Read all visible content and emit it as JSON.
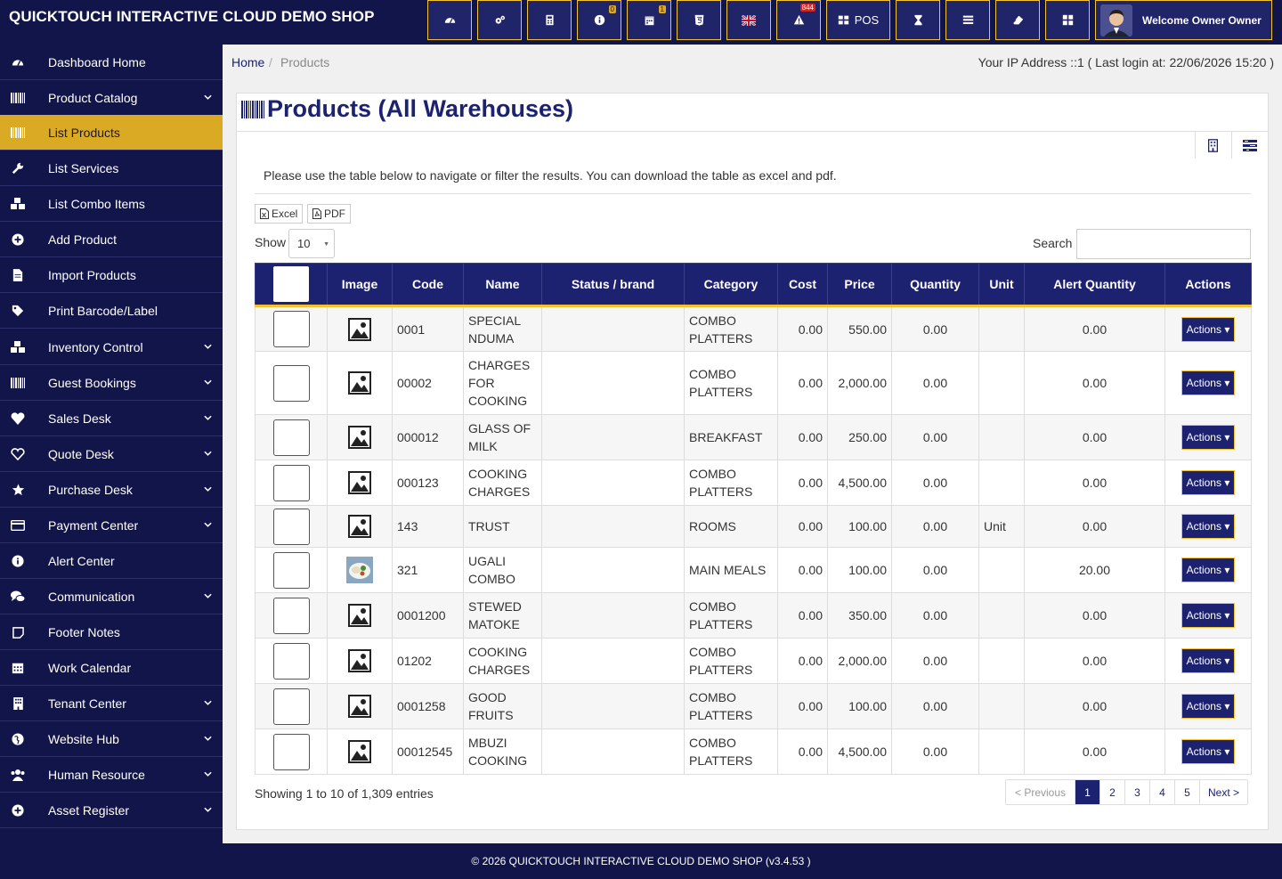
{
  "app": {
    "brand": "QUICKTOUCH INTERACTIVE CLOUD DEMO SHOP",
    "welcome": "Welcome Owner Owner",
    "toolbar": {
      "pos_label": "POS",
      "badge_info": "0",
      "badge_calendar": "1",
      "badge_alert": "844"
    }
  },
  "sidebar": {
    "items": [
      {
        "label": "Dashboard Home",
        "icon": "dashboard-icon"
      },
      {
        "label": "Product Catalog",
        "icon": "barcode-icon"
      },
      {
        "label": "List Products",
        "icon": "barcode-icon"
      },
      {
        "label": "List Services",
        "icon": "wrench-icon"
      },
      {
        "label": "List Combo Items",
        "icon": "cubes-icon"
      },
      {
        "label": "Add Product",
        "icon": "plus-circle-icon"
      },
      {
        "label": "Import Products",
        "icon": "file-icon"
      },
      {
        "label": "Print Barcode/Label",
        "icon": "tags-icon"
      },
      {
        "label": "Inventory Control",
        "icon": "cubes-icon"
      },
      {
        "label": "Guest Bookings",
        "icon": "barcode-icon"
      },
      {
        "label": "Sales Desk",
        "icon": "heart-icon"
      },
      {
        "label": "Quote Desk",
        "icon": "heart-outline-icon"
      },
      {
        "label": "Purchase Desk",
        "icon": "star-icon"
      },
      {
        "label": "Payment Center",
        "icon": "credit-card-icon"
      },
      {
        "label": "Alert Center",
        "icon": "info-circle-icon"
      },
      {
        "label": "Communication",
        "icon": "comments-icon"
      },
      {
        "label": "Footer Notes",
        "icon": "note-icon"
      },
      {
        "label": "Work Calendar",
        "icon": "calendar-icon"
      },
      {
        "label": "Tenant Center",
        "icon": "building-icon"
      },
      {
        "label": "Website Hub",
        "icon": "globe-icon"
      },
      {
        "label": "Human Resource",
        "icon": "users-icon"
      },
      {
        "label": "Asset Register",
        "icon": "plus-circle-icon"
      }
    ]
  },
  "breadcrumb": {
    "home": "Home",
    "current": "Products",
    "ip_info": "Your IP Address ::1 ( Last login at: 22/06/2026 15:20 )"
  },
  "page": {
    "title": "Products (All Warehouses)",
    "info": "Please use the table below to navigate or filter the results. You can download the table as excel and pdf.",
    "excel_label": "Excel",
    "pdf_label": "PDF",
    "show_label": "Show",
    "show_value": "10",
    "search_label": "Search",
    "search_value": ""
  },
  "table": {
    "headers": [
      "",
      "Image",
      "Code",
      "Name",
      "Status / brand",
      "Category",
      "Cost",
      "Price",
      "Quantity",
      "Unit",
      "Alert Quantity",
      "Actions"
    ],
    "action_label": "Actions",
    "rows": [
      {
        "image": "placeholder",
        "code": "0001",
        "name": "SPECIAL NDUMA",
        "status": "",
        "category": "COMBO PLATTERS",
        "cost": "0.00",
        "price": "550.00",
        "quantity": "0.00",
        "unit": "",
        "alert": "0.00"
      },
      {
        "image": "placeholder",
        "code": "00002",
        "name": "CHARGES FOR COOKING",
        "status": "",
        "category": "COMBO PLATTERS",
        "cost": "0.00",
        "price": "2,000.00",
        "quantity": "0.00",
        "unit": "",
        "alert": "0.00"
      },
      {
        "image": "placeholder",
        "code": "000012",
        "name": "GLASS OF MILK",
        "status": "",
        "category": "BREAKFAST",
        "cost": "0.00",
        "price": "250.00",
        "quantity": "0.00",
        "unit": "",
        "alert": "0.00"
      },
      {
        "image": "placeholder",
        "code": "000123",
        "name": "COOKING CHARGES",
        "status": "",
        "category": "COMBO PLATTERS",
        "cost": "0.00",
        "price": "4,500.00",
        "quantity": "0.00",
        "unit": "",
        "alert": "0.00"
      },
      {
        "image": "placeholder",
        "code": "143",
        "name": "TRUST",
        "status": "",
        "category": "ROOMS",
        "cost": "0.00",
        "price": "100.00",
        "quantity": "0.00",
        "unit": "Unit",
        "alert": "0.00"
      },
      {
        "image": "photo",
        "code": "321",
        "name": "UGALI COMBO",
        "status": "",
        "category": "MAIN MEALS",
        "cost": "0.00",
        "price": "100.00",
        "quantity": "0.00",
        "unit": "",
        "alert": "20.00"
      },
      {
        "image": "placeholder",
        "code": "0001200",
        "name": "STEWED MATOKE",
        "status": "",
        "category": "COMBO PLATTERS",
        "cost": "0.00",
        "price": "350.00",
        "quantity": "0.00",
        "unit": "",
        "alert": "0.00"
      },
      {
        "image": "placeholder",
        "code": "01202",
        "name": "COOKING CHARGES",
        "status": "",
        "category": "COMBO PLATTERS",
        "cost": "0.00",
        "price": "2,000.00",
        "quantity": "0.00",
        "unit": "",
        "alert": "0.00"
      },
      {
        "image": "placeholder",
        "code": "0001258",
        "name": "GOOD FRUITS",
        "status": "",
        "category": "COMBO PLATTERS",
        "cost": "0.00",
        "price": "100.00",
        "quantity": "0.00",
        "unit": "",
        "alert": "0.00"
      },
      {
        "image": "placeholder",
        "code": "00012545",
        "name": "MBUZI COOKING",
        "status": "",
        "category": "COMBO PLATTERS",
        "cost": "0.00",
        "price": "4,500.00",
        "quantity": "0.00",
        "unit": "",
        "alert": "0.00"
      }
    ]
  },
  "footer_table": {
    "entries": "Showing 1 to 10 of 1,309 entries",
    "pager": {
      "previous": "< Previous",
      "pages": [
        "1",
        "2",
        "3",
        "4",
        "5"
      ],
      "next": "Next >",
      "current": "1"
    }
  },
  "footer": {
    "text": "© 2026 QUICKTOUCH INTERACTIVE CLOUD DEMO SHOP (v3.4.53 )"
  },
  "colors": {
    "navy": "#12154a",
    "accent_gold": "#dbaa24",
    "header_blue": "#1c2270"
  }
}
